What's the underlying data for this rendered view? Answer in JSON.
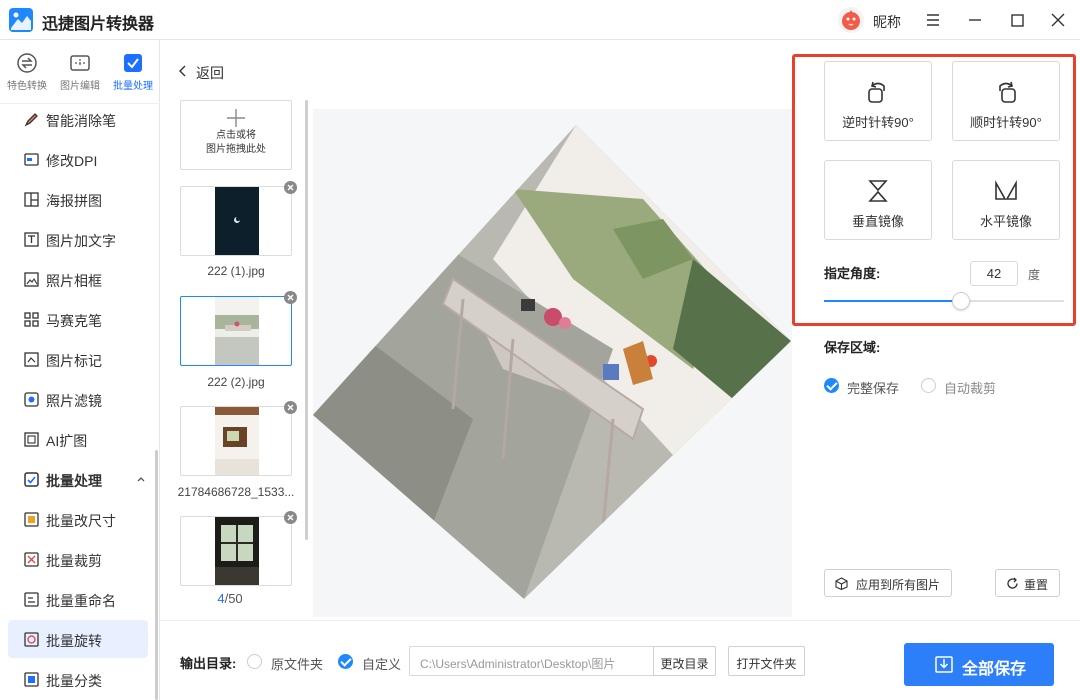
{
  "app": {
    "title": "迅捷图片转换器",
    "nickname": "昵称"
  },
  "colors": {
    "accent": "#2d7ff9",
    "highlight_frame": "#e8402a",
    "selected_bg": "#e8f0ff"
  },
  "topnav": [
    {
      "label": "特色转换",
      "icon": "convert-icon"
    },
    {
      "label": "图片编辑",
      "icon": "edit-icon"
    },
    {
      "label": "批量处理",
      "icon": "batch-icon",
      "active": true
    }
  ],
  "sidebar": {
    "items": [
      {
        "label": "智能消除笔",
        "icon": "eraser-pen-icon"
      },
      {
        "label": "修改DPI",
        "icon": "dpi-icon"
      },
      {
        "label": "海报拼图",
        "icon": "collage-icon"
      },
      {
        "label": "图片加文字",
        "icon": "text-icon"
      },
      {
        "label": "照片相框",
        "icon": "frame-icon"
      },
      {
        "label": "马赛克笔",
        "icon": "mosaic-icon"
      },
      {
        "label": "图片标记",
        "icon": "mark-icon"
      },
      {
        "label": "照片滤镜",
        "icon": "filter-icon"
      },
      {
        "label": "AI扩图",
        "icon": "ai-expand-icon"
      }
    ],
    "section": {
      "label": "批量处理",
      "icon": "batch-icon"
    },
    "subitems": [
      {
        "label": "批量改尺寸",
        "icon": "resize-icon"
      },
      {
        "label": "批量裁剪",
        "icon": "crop-icon"
      },
      {
        "label": "批量重命名",
        "icon": "rename-icon"
      },
      {
        "label": "批量旋转",
        "icon": "rotate-icon",
        "active": true
      },
      {
        "label": "批量分类",
        "icon": "classify-icon"
      }
    ]
  },
  "main": {
    "back_label": "返回",
    "add_tile": {
      "line1": "点击或将",
      "line2": "图片拖拽此处"
    },
    "thumbnails": [
      {
        "name": "222 (1).jpg"
      },
      {
        "name": "222 (2).jpg",
        "selected": true
      },
      {
        "name": "21784686728_1533..."
      },
      {
        "name": ""
      }
    ],
    "counter": {
      "current": "4",
      "total": "/50"
    }
  },
  "panel": {
    "rotate_ccw": "逆时针转90°",
    "rotate_cw": "顺时针转90°",
    "flip_vertical": "垂直镜像",
    "flip_horizontal": "水平镜像",
    "angle_label": "指定角度:",
    "angle_value": "42",
    "angle_unit": "度",
    "angle_level": 0.57,
    "save_area_label": "保存区域:",
    "save_full": "完整保存",
    "save_crop": "自动裁剪",
    "apply_all": "应用到所有图片",
    "reset": "重置"
  },
  "bottom": {
    "output_label": "输出目录:",
    "option_original": "原文件夹",
    "option_custom": "自定义",
    "path_value": "C:\\Users\\Administrator\\Desktop\\图片",
    "change_dir": "更改目录",
    "open_folder": "打开文件夹",
    "save_all": "全部保存"
  }
}
